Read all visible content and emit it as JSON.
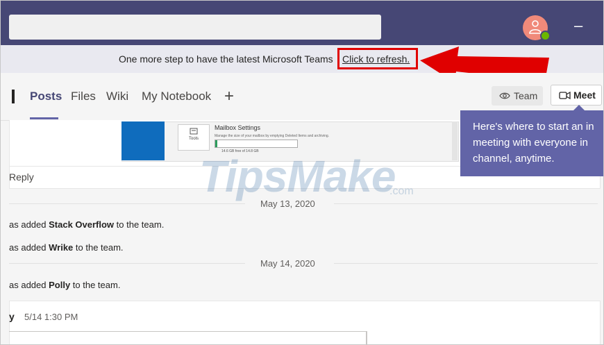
{
  "colors": {
    "teams_purple": "#464775",
    "accent": "#6264a7",
    "alert_red": "#e00000",
    "presence_green": "#6bb700"
  },
  "topbar": {
    "minimize_label": "–"
  },
  "banner": {
    "text": "One more step to have the latest Microsoft Teams",
    "link": "Click to refresh."
  },
  "tabs": [
    {
      "label": "Posts"
    },
    {
      "label": "Files"
    },
    {
      "label": "Wiki"
    },
    {
      "label": "My Notebook"
    }
  ],
  "tab_add_label": "+",
  "buttons": {
    "team_label": "Team",
    "meet_label": "Meet",
    "team_icon": "eye-icon",
    "meet_icon": "video-camera-icon"
  },
  "tooltip": {
    "lines": [
      "Here's where to start an in",
      "meeting with everyone in",
      "channel, anytime."
    ]
  },
  "post": {
    "screenshot": {
      "tools_label": "Tools",
      "title": "Mailbox Settings",
      "desc": "Manage the size of your mailbox by emptying Deleted Items and archiving.",
      "size": "14.6 GB free of 14.8 GB"
    },
    "reply_label": "Reply"
  },
  "feed": [
    {
      "date": "May 13, 2020"
    },
    {
      "prefix": "as added ",
      "name": "Stack Overflow",
      "suffix": " to the team."
    },
    {
      "prefix": "as added ",
      "name": "Wrike",
      "suffix": " to the team."
    },
    {
      "date": "May 14, 2020"
    },
    {
      "prefix": "as added ",
      "name": "Polly",
      "suffix": " to the team."
    }
  ],
  "message": {
    "author": "y",
    "timestamp": "5/14 1:30 PM"
  },
  "watermark": {
    "main": "TipsMake",
    "suffix": ".com"
  }
}
